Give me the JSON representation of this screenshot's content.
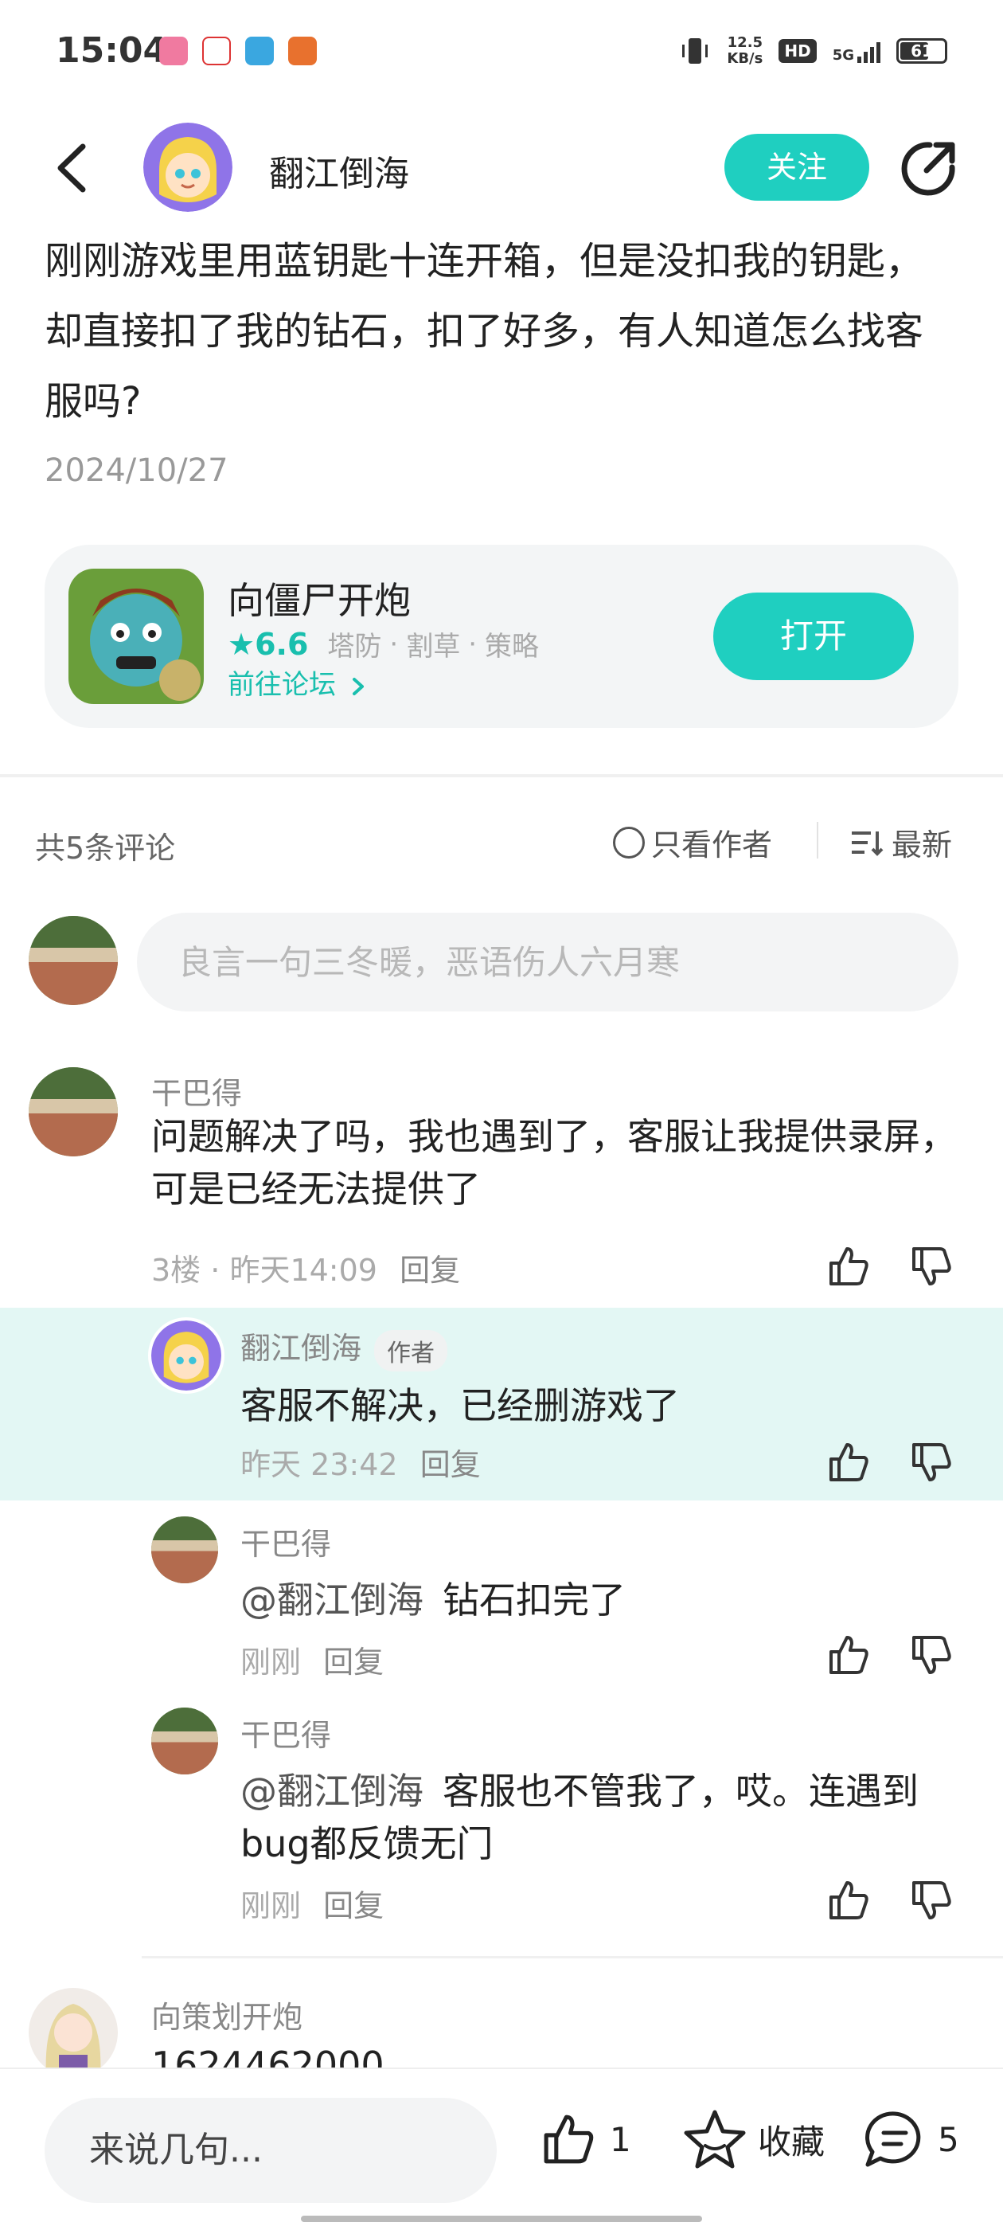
{
  "status_bar": {
    "time": "15:04",
    "net_speed": "12.5",
    "net_unit": "KB/s",
    "hd": "HD",
    "network": "5G",
    "battery": "61"
  },
  "header": {
    "author_name": "翻江倒海",
    "follow_label": "关注"
  },
  "post": {
    "text": "刚刚游戏里用蓝钥匙十连开箱，但是没扣我的钥匙，却直接扣了我的钻石，扣了好多，有人知道怎么找客服吗?",
    "date": "2024/10/27"
  },
  "game_card": {
    "name": "向僵尸开炮",
    "rating": "6.6",
    "tags": [
      "塔防",
      "割草",
      "策略"
    ],
    "forum_link": "前往论坛",
    "open_label": "打开"
  },
  "comments_header": {
    "count_label": "共5条评论",
    "author_only_label": "只看作者",
    "sort_label": "最新"
  },
  "comment_input": {
    "placeholder": "良言一句三冬暖，恶语伤人六月寒"
  },
  "comments": [
    {
      "name": "干巴得",
      "text": "问题解决了吗，我也遇到了，客服让我提供录屏，可是已经无法提供了",
      "floor": "3楼",
      "time": "昨天14:09",
      "reply_label": "回复"
    },
    {
      "name": "翻江倒海",
      "badge": "作者",
      "text": "客服不解决，已经删游戏了",
      "time": "昨天 23:42",
      "reply_label": "回复"
    },
    {
      "name": "干巴得",
      "mention": "@翻江倒海",
      "text": "钻石扣完了",
      "time": "刚刚",
      "reply_label": "回复"
    },
    {
      "name": "干巴得",
      "mention": "@翻江倒海",
      "text": "客服也不管我了，哎。连遇到bug都反馈无门",
      "time": "刚刚",
      "reply_label": "回复"
    },
    {
      "name": "向策划开炮",
      "text": "1624462000"
    }
  ],
  "bottom_bar": {
    "input_label": "来说几句...",
    "like_count": "1",
    "collect_label": "收藏",
    "comment_count": "5"
  },
  "colors": {
    "accent": "#1fcfc0",
    "highlight": "#e3f7f4"
  }
}
